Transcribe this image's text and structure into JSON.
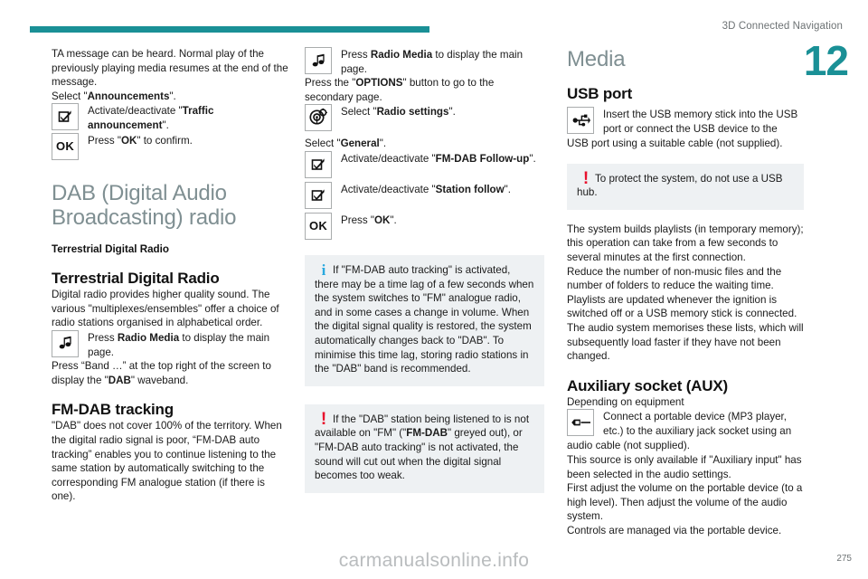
{
  "header": {
    "title": "3D Connected Navigation",
    "chapter_number": "12",
    "rule_color": "#1a9096"
  },
  "footer": {
    "brand": "carmanualsonline.info",
    "page_number": "275"
  },
  "column_left": {
    "intro_para": "TA message can be heard. Normal play of the previously playing media resumes at the end of the message.",
    "select_line_prefix": "Select \"",
    "select_line_bold": "Announcements",
    "select_line_suffix": "\".",
    "step_checkbox_1": {
      "icon": "checkbox-checked-icon",
      "text_prefix": "Activate/deactivate \"",
      "text_bold": "Traffic announcement",
      "text_suffix": "\"."
    },
    "step_ok": {
      "icon": "ok-button-icon",
      "icon_label": "OK",
      "text_prefix": "Press \"",
      "text_bold": "OK",
      "text_suffix": "\" to confirm."
    },
    "section_title": "DAB (Digital Audio Broadcasting) radio",
    "mini_title": "Terrestrial Digital Radio",
    "sub_title": "Terrestrial Digital Radio",
    "body_1": "Digital radio provides higher quality sound. The various \"multiplexes/ensembles\" offer a choice of radio stations organised in alphabetical order.",
    "step_radio_media": {
      "icon": "music-note-icon",
      "text_prefix": "Press ",
      "text_bold": "Radio Media",
      "text_suffix": " to display the main page."
    },
    "body_2_prefix": "Press “Band …” at the top right of the screen to display the \"",
    "body_2_bold": "DAB",
    "body_2_suffix": "\" waveband.",
    "sub_title_2": "FM-DAB tracking",
    "body_3": "\"DAB\" does not cover 100% of the territory. When the digital radio signal is poor, “FM-DAB  auto tracking” enables you to continue listening to the same station by automatically switching to the corresponding FM analogue station (if there is one)."
  },
  "column_middle": {
    "step_radio_media": {
      "icon": "music-note-icon",
      "text_prefix": "Press ",
      "text_bold": "Radio Media",
      "text_suffix": " to display the main page."
    },
    "body_1_prefix": "Press the \"",
    "body_1_bold": "OPTIONS",
    "body_1_suffix": "\" button to go to the secondary page.",
    "step_radio_settings": {
      "icon": "radio-settings-icon",
      "text_prefix": "Select \"",
      "text_bold": "Radio settings",
      "text_suffix": "\"."
    },
    "select_general_prefix": "Select \"",
    "select_general_bold": "General",
    "select_general_suffix": "\".",
    "step_checkbox_1": {
      "icon": "checkbox-checked-icon",
      "text_prefix": "Activate/deactivate \"",
      "text_bold": "FM-DAB Follow-up",
      "text_suffix": "\"."
    },
    "step_checkbox_2": {
      "icon": "checkbox-checked-icon",
      "text_prefix": "Activate/deactivate \"",
      "text_bold": "Station follow",
      "text_suffix": "\"."
    },
    "step_ok": {
      "icon": "ok-button-icon",
      "icon_label": "OK",
      "text_prefix": "Press \"",
      "text_bold": "OK",
      "text_suffix": "\"."
    },
    "info_callout": {
      "mark": "i",
      "mark_name": "info-icon",
      "mark_color": "#29a9df",
      "text": "If \"FM-DAB auto tracking\" is activated, there may be a time lag of a few seconds when the system switches to \"FM\" analogue radio, and in some cases a change in volume. When the digital signal quality is restored, the system automatically changes back to \"DAB\". To minimise this time lag, storing radio stations in the \"DAB\" band is recommended."
    },
    "warning_callout": {
      "mark": "!",
      "mark_name": "warning-icon",
      "mark_color": "#e8112d",
      "text_1": "If the \"DAB\" station being listened to is not available on \"FM\" (\"",
      "text_bold": "FM-DAB",
      "text_2": "\" greyed out), or \"FM-DAB auto tracking\" is not activated, the sound will cut out when the digital signal becomes too weak."
    }
  },
  "column_right": {
    "section_title": "Media",
    "sub_title": "USB port",
    "step_usb": {
      "icon": "usb-icon",
      "text": "Insert the USB memory stick into the USB port or connect the USB device to the"
    },
    "usb_continued": "USB port using a suitable cable (not supplied).",
    "warning_callout": {
      "mark": "!",
      "mark_name": "warning-icon",
      "mark_color": "#e8112d",
      "text": "To protect the system, do not use a USB hub."
    },
    "body_1": "The system builds playlists (in temporary memory); this operation can take from a few seconds to several minutes at the first connection.",
    "body_2": "Reduce the number of non-music files and the number of folders to reduce the waiting time.",
    "body_3": "Playlists are updated whenever the ignition is switched off or a USB memory stick is connected. The audio system memorises these lists, which will subsequently load faster if they have not been changed.",
    "sub_title_2": "Auxiliary socket (AUX)",
    "depending": "Depending on equipment",
    "step_aux": {
      "icon": "jack-plug-icon",
      "text": "Connect a portable device (MP3 player, etc.) to the auxiliary jack socket using an"
    },
    "aux_continued": "audio cable (not supplied).",
    "body_4": "This source is only available if \"Auxiliary input\" has been selected in the audio settings.",
    "body_5": "First adjust the volume on the portable device (to a high level). Then adjust the volume of the audio system.",
    "body_6": "Controls are managed via the portable device."
  }
}
